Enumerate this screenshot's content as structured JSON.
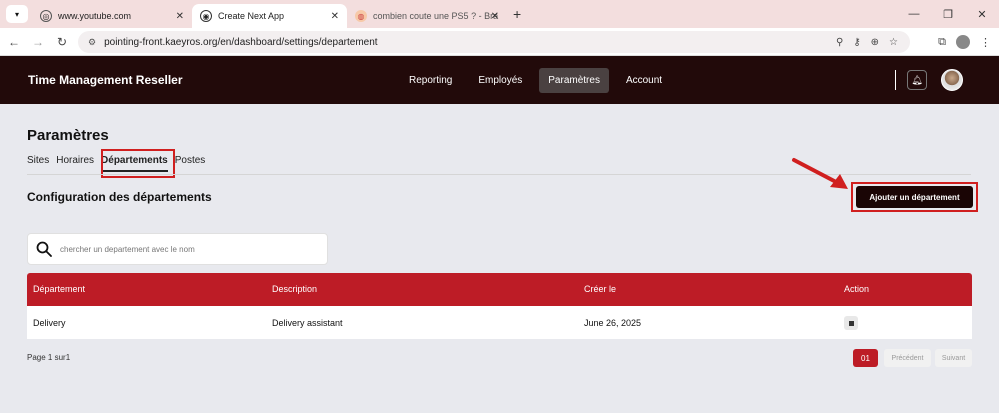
{
  "browser": {
    "tabs": [
      {
        "title": "www.youtube.com",
        "active": false
      },
      {
        "title": "Create Next App",
        "active": true
      },
      {
        "title": "combien coute une PS5 ? - Bra",
        "active": false
      }
    ],
    "url": "pointing-front.kaeyros.org/en/dashboard/settings/departement"
  },
  "app": {
    "brand": "Time Management Reseller",
    "nav": [
      "Reporting",
      "Employés",
      "Paramètres",
      "Account"
    ],
    "nav_selected": "Paramètres"
  },
  "page": {
    "title": "Paramètres",
    "tabs": [
      "Sites",
      "Horaires",
      "Départements",
      "Postes"
    ],
    "tab_selected": "Départements",
    "section_title": "Configuration des départements",
    "add_button": "Ajouter un département",
    "search_placeholder": "chercher un departement avec le nom"
  },
  "table": {
    "columns": [
      "Département",
      "Description",
      "Créer le",
      "Action"
    ],
    "rows": [
      {
        "departement": "Delivery",
        "description": "Delivery assistant",
        "created": "June 26, 2025"
      }
    ]
  },
  "pagination": {
    "info": "Page 1 sur1",
    "current": "01",
    "prev": "Précédent",
    "next": "Suivant"
  },
  "colors": {
    "header_bg": "#220a0a",
    "table_header": "#bd1c26",
    "highlight": "#d01f1f"
  }
}
